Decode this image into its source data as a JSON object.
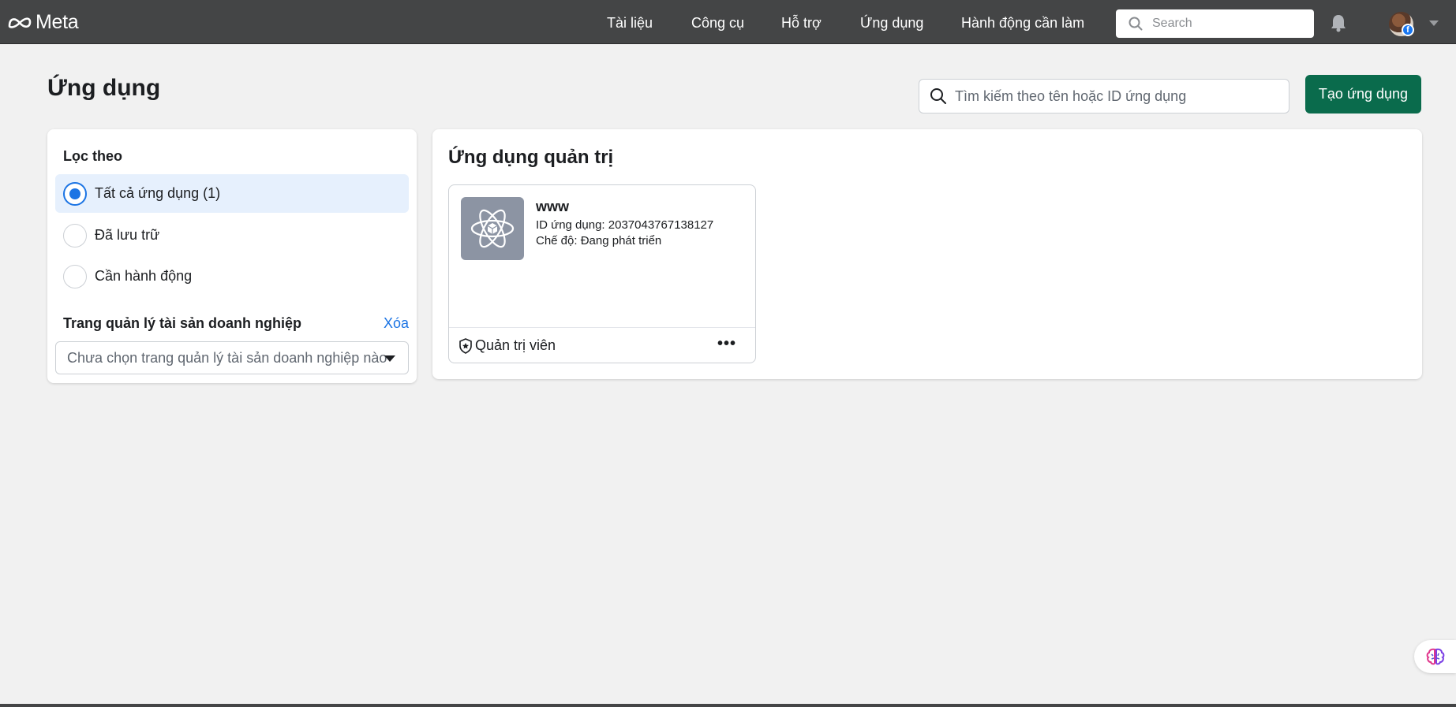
{
  "brand": {
    "name": "Meta"
  },
  "nav": {
    "items": [
      "Tài liệu",
      "Công cụ",
      "Hỗ trợ",
      "Ứng dụng",
      "Hành động cần làm"
    ],
    "search_placeholder": "Search"
  },
  "page": {
    "title": "Ứng dụng",
    "search_placeholder": "Tìm kiếm theo tên hoặc ID ứng dụng",
    "create_button": "Tạo ứng dụng"
  },
  "filter": {
    "title": "Lọc theo",
    "options": [
      {
        "label": "Tất cả ứng dụng (1)",
        "selected": true
      },
      {
        "label": "Đã lưu trữ",
        "selected": false
      },
      {
        "label": "Cần hành động",
        "selected": false
      }
    ],
    "business_manager_label": "Trang quản lý tài sản doanh nghiệp",
    "clear_label": "Xóa",
    "business_manager_placeholder": "Chưa chọn trang quản lý tài sản doanh nghiệp nào"
  },
  "apps": {
    "section_title": "Ứng dụng quản trị",
    "items": [
      {
        "name": "www",
        "id_line": "ID ứng dụng: 2037043767138127",
        "mode_line": "Chế độ: Đang phát triển",
        "role": "Quản trị viên",
        "icon": "atom-icon"
      }
    ]
  },
  "colors": {
    "topbar": "#444546",
    "primary_button": "#0a6b4c",
    "accent": "#1b74e4",
    "selected_row": "#e6f0fd"
  }
}
